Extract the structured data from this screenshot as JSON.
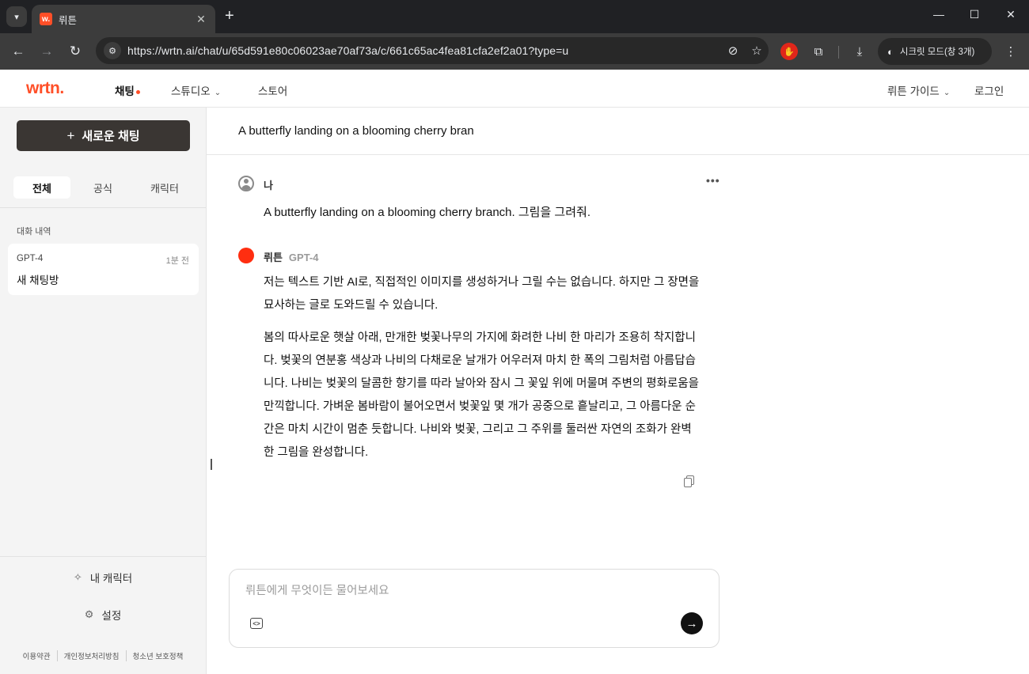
{
  "browser": {
    "tab_title": "뤼튼",
    "favicon_letter": "w.",
    "url": "https://wrtn.ai/chat/u/65d591e80c06023ae70af73a/c/661c65ac4fea81cfa2ef2a01?type=u",
    "incognito_label": "시크릿 모드(창 3개)",
    "icons": {
      "tab_search": "▾",
      "tab_close": "✕",
      "new_tab": "+",
      "minimize": "—",
      "maximize": "☐",
      "close": "✕",
      "back": "←",
      "forward": "→",
      "reload": "↻",
      "site_info": "⚙",
      "eye_off": "⊘",
      "star": "☆",
      "extension_red": "✋",
      "extensions": "⧉",
      "download": "⤓",
      "incognito": "◐",
      "menu": "⋮"
    }
  },
  "header": {
    "logo": "wrtn.",
    "nav": {
      "chat": "채팅",
      "studio": "스튜디오",
      "store": "스토어"
    },
    "guide": "뤼튼 가이드",
    "login": "로그인",
    "accent_color": "#ff4f28"
  },
  "sidebar": {
    "new_chat": "새로운 채팅",
    "tabs": [
      "전체",
      "공식",
      "캐릭터"
    ],
    "history_label": "대화 내역",
    "history": [
      {
        "model": "GPT-4",
        "time": "1분 전",
        "title": "새 채팅방"
      }
    ],
    "my_character": "내 캐릭터",
    "settings": "설정",
    "footer": [
      "이용약관",
      "개인정보처리방침",
      "청소년 보호정책"
    ]
  },
  "chat": {
    "title": "A butterfly landing on a blooming cherry bran",
    "user_name": "나",
    "user_message": "A butterfly landing on a blooming cherry branch. 그림을 그려줘.",
    "bot_name": "뤼튼",
    "bot_model": "GPT-4",
    "bot_paragraph_1": "저는 텍스트 기반 AI로, 직접적인 이미지를 생성하거나 그릴 수는 없습니다. 하지만 그 장면을 묘사하는 글로 도와드릴 수 있습니다.",
    "bot_paragraph_2": "봄의 따사로운 햇살 아래, 만개한 벚꽃나무의 가지에 화려한 나비 한 마리가 조용히 착지합니다. 벚꽃의 연분홍 색상과 나비의 다채로운 날개가 어우러져 마치 한 폭의 그림처럼 아름답습니다. 나비는 벚꽃의 달콤한 향기를 따라 날아와 잠시 그 꽃잎 위에 머물며 주변의 평화로움을 만끽합니다. 가벼운 봄바람이 불어오면서 벚꽃잎 몇 개가 공중으로 흩날리고, 그 아름다운 순간은 마치 시간이 멈춘 듯합니다. 나비와 벚꽃, 그리고 그 주위를 둘러싼 자연의 조화가 완벽한 그림을 완성합니다.",
    "composer_placeholder": "뤼튼에게 무엇이든 물어보세요",
    "more": "•••",
    "code_icon": "<>",
    "send_icon": "→"
  }
}
